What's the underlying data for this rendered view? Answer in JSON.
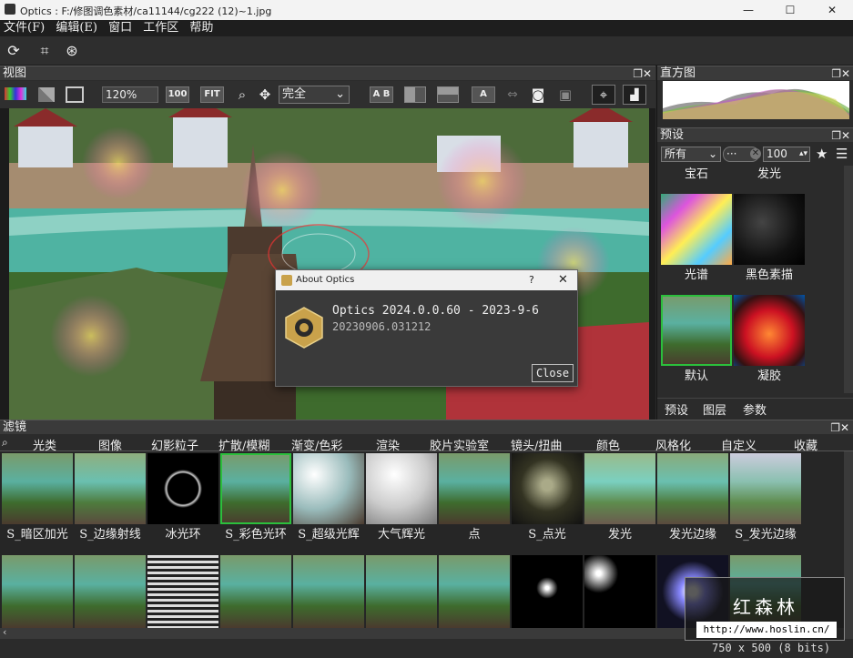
{
  "window": {
    "title": "Optics : F:/修图调色素材/ca11144/cg222 (12)~1.jpg",
    "min": "—",
    "max": "☐",
    "close": "✕"
  },
  "menu": [
    "文件(F)",
    "编辑(E)",
    "窗口",
    "工作区",
    "帮助"
  ],
  "view": {
    "title": "视图",
    "zoom": "120%",
    "btn100": "100",
    "btnfit": "FIT",
    "mode": "完全",
    "ab": "A B"
  },
  "dialog": {
    "title": "About Optics",
    "help": "?",
    "close_x": "✕",
    "heading": "Optics 2024.0.0.60 - 2023-9-6",
    "build": "20230906.031212",
    "close_btn": "Close"
  },
  "histogram": {
    "title": "直方图"
  },
  "presets": {
    "title": "预设",
    "filter": "所有",
    "more": "···",
    "size": "100",
    "top_labels": [
      "宝石",
      "发光"
    ],
    "items": [
      {
        "label": "光谱"
      },
      {
        "label": "黑色素描"
      },
      {
        "label": "默认"
      },
      {
        "label": "凝胶"
      }
    ],
    "tabs": [
      "预设",
      "图层",
      "参数"
    ]
  },
  "filters": {
    "title": "滤镜",
    "categories": [
      "光类",
      "图像",
      "幻影粒子",
      "扩散/模糊",
      "渐变/色彩",
      "渲染",
      "胶片实验室",
      "镜头/扭曲",
      "颜色",
      "风格化",
      "自定义",
      "收藏"
    ],
    "row1": [
      "S_暗区加光",
      "S_边缘射线",
      "冰光环",
      "S_彩色光环",
      "S_超级光辉",
      "大气辉光",
      "点",
      "S_点光",
      "发光",
      "发光边缘",
      "S_发光边缘"
    ]
  },
  "status": {
    "dims": "750 x 500 (8 bits)"
  },
  "watermark": {
    "name": "红森林",
    "url": "http://www.hoslin.cn/"
  }
}
